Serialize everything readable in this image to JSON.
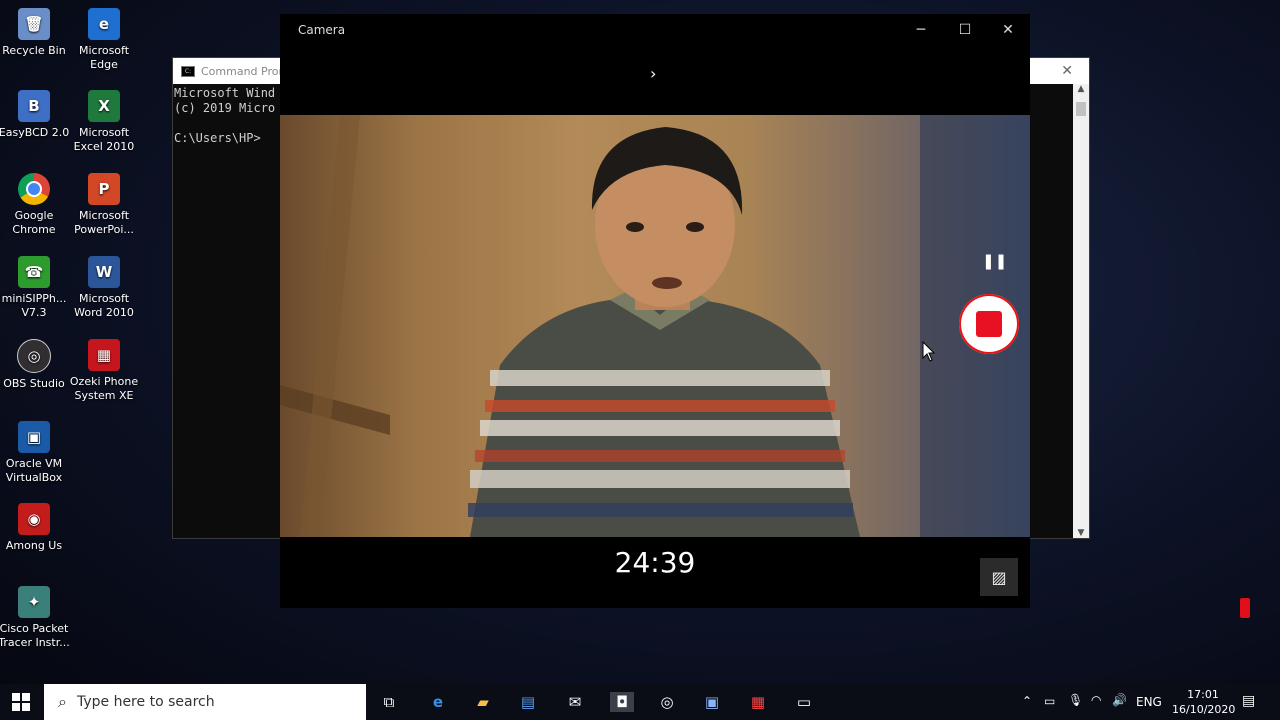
{
  "desktop": {
    "icons": [
      {
        "label_line1": "Recycle Bin",
        "label_line2": "",
        "color": "#5b8fd6",
        "glyph": "🗑"
      },
      {
        "label_line1": "Microsoft",
        "label_line2": "Edge",
        "color": "#1f6fd1",
        "glyph": "e"
      },
      {
        "label_line1": "EasyBCD 2.0",
        "label_line2": "",
        "color": "#3d6fc4",
        "glyph": "B"
      },
      {
        "label_line1": "Microsoft",
        "label_line2": "Excel 2010",
        "color": "#1e7a3c",
        "glyph": "X"
      },
      {
        "label_line1": "Google",
        "label_line2": "Chrome",
        "color": "#db4437",
        "glyph": "●"
      },
      {
        "label_line1": "Microsoft",
        "label_line2": "PowerPoi...",
        "color": "#d24726",
        "glyph": "P"
      },
      {
        "label_line1": "miniSIPPh...",
        "label_line2": "V7.3",
        "color": "#2e9b2e",
        "glyph": "☎"
      },
      {
        "label_line1": "Microsoft",
        "label_line2": "Word 2010",
        "color": "#2b579a",
        "glyph": "W"
      },
      {
        "label_line1": "OBS Studio",
        "label_line2": "",
        "color": "#302e31",
        "glyph": "◎"
      },
      {
        "label_line1": "Ozeki Phone",
        "label_line2": "System XE",
        "color": "#c4161c",
        "glyph": "▦"
      },
      {
        "label_line1": "Oracle VM",
        "label_line2": "VirtualBox",
        "color": "#1b5aa6",
        "glyph": "▣"
      },
      {
        "label_line1": "Among Us",
        "label_line2": "",
        "color": "#c21c1c",
        "glyph": "◉"
      },
      {
        "label_line1": "Cisco Packet",
        "label_line2": "Tracer Instr...",
        "color": "#3a7f7a",
        "glyph": "✦"
      }
    ]
  },
  "cmd": {
    "title": "Command Prom",
    "line1": "Microsoft Wind",
    "line2": "(c) 2019 Micro",
    "line3": "C:\\Users\\HP>"
  },
  "camera": {
    "title": "Camera",
    "timer": "24:39"
  },
  "taskbar": {
    "search_placeholder": "Type here to search",
    "language": "ENG",
    "time": "17:01",
    "date": "16/10/2020"
  }
}
